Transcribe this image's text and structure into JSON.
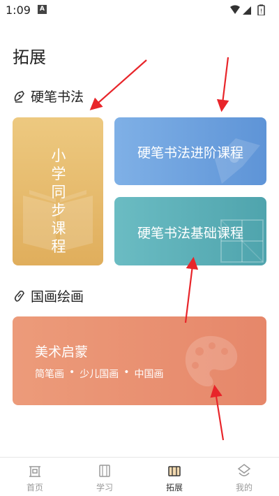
{
  "status_bar": {
    "time": "1:09",
    "notification_badge": "A"
  },
  "page": {
    "title": "拓展"
  },
  "sections": [
    {
      "label": "硬笔书法",
      "icon": "pen-nib-icon",
      "cards": [
        {
          "label": "小学同步课程",
          "chars": [
            "小",
            "学",
            "同",
            "步",
            "课",
            "程"
          ],
          "color": "#e5b768"
        },
        {
          "label": "硬笔书法进阶课程",
          "color": "#6ea3de"
        },
        {
          "label": "硬笔书法基础课程",
          "color": "#5cb0b8"
        }
      ]
    },
    {
      "label": "国画绘画",
      "icon": "brush-icon",
      "cards": [
        {
          "title": "美术启蒙",
          "tags": [
            "简笔画",
            "少儿国画",
            "中国画"
          ],
          "separator": "•",
          "color": "#e9927a"
        }
      ]
    }
  ],
  "bottom_nav": {
    "items": [
      {
        "label": "首页",
        "icon": "home-icon",
        "active": false
      },
      {
        "label": "学习",
        "icon": "film-icon",
        "active": false
      },
      {
        "label": "拓展",
        "icon": "expand-icon",
        "active": true
      },
      {
        "label": "我的",
        "icon": "profile-icon",
        "active": false
      }
    ]
  },
  "colors": {
    "annotation_arrow": "#e8252a",
    "nav_inactive": "#999999"
  }
}
